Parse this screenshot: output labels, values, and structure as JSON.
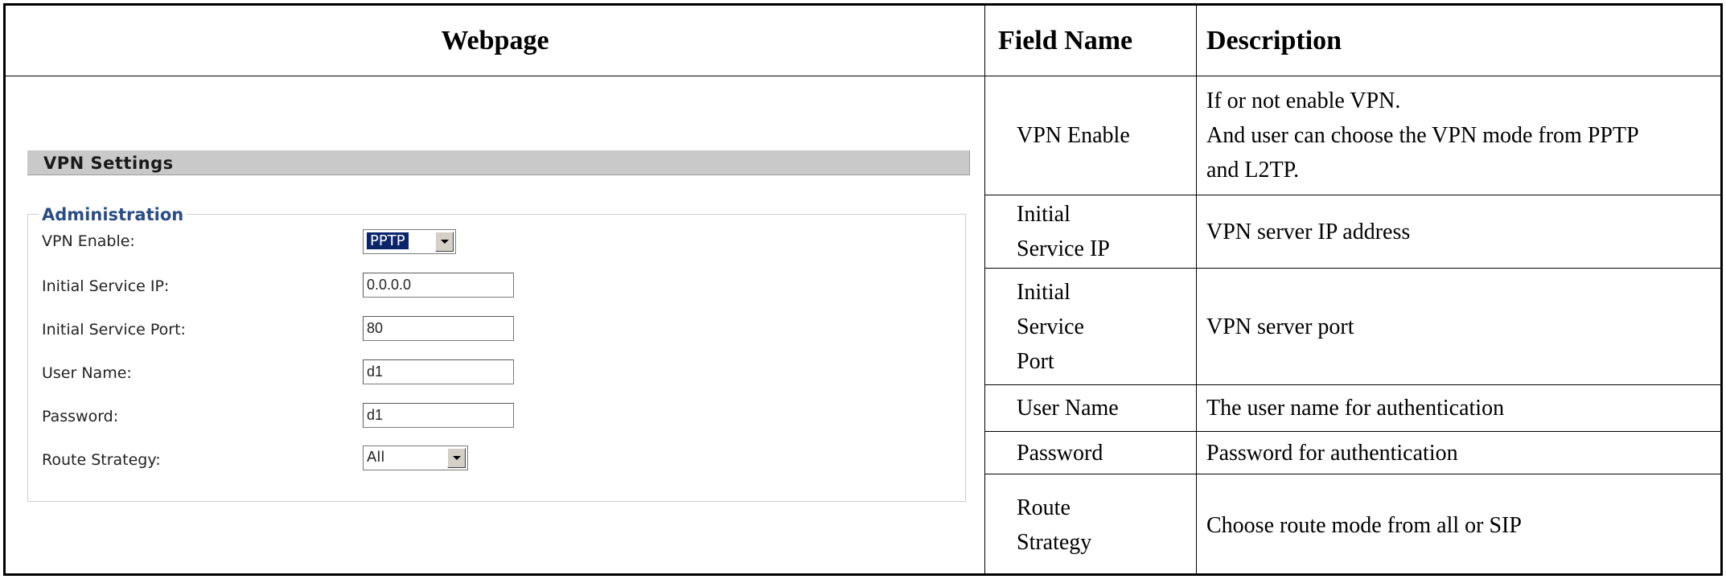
{
  "headers": {
    "webpage": "Webpage",
    "field_name": "Field Name",
    "description": "Description"
  },
  "webpage": {
    "section_title": "VPN Settings",
    "fieldset_legend": "Administration",
    "fields": {
      "vpn_enable": {
        "label": "VPN Enable:",
        "value": "PPTP"
      },
      "initial_service_ip": {
        "label": "Initial Service IP:",
        "value": "0.0.0.0"
      },
      "initial_service_port": {
        "label": "Initial Service Port:",
        "value": "80"
      },
      "user_name": {
        "label": "User Name:",
        "value": "d1"
      },
      "password": {
        "label": "Password:",
        "value": "d1"
      },
      "route_strategy": {
        "label": "Route Strategy:",
        "value": "All"
      }
    },
    "icons": {
      "dropdown": "chevron-down-icon"
    }
  },
  "rows": [
    {
      "field": [
        "VPN Enable"
      ],
      "description": [
        "If or not enable VPN.",
        "And user can choose the VPN mode from PPTP",
        "and L2TP."
      ]
    },
    {
      "field": [
        "Initial",
        "Service IP"
      ],
      "description": [
        "VPN server IP address"
      ]
    },
    {
      "field": [
        "Initial",
        "Service",
        "Port"
      ],
      "description": [
        "VPN server port"
      ]
    },
    {
      "field": [
        "User Name"
      ],
      "description": [
        "The user name for authentication"
      ]
    },
    {
      "field": [
        "Password"
      ],
      "description": [
        "Password for authentication"
      ]
    },
    {
      "field": [
        "Route",
        "Strategy"
      ],
      "description": [
        "Choose route mode from all or SIP"
      ]
    }
  ]
}
